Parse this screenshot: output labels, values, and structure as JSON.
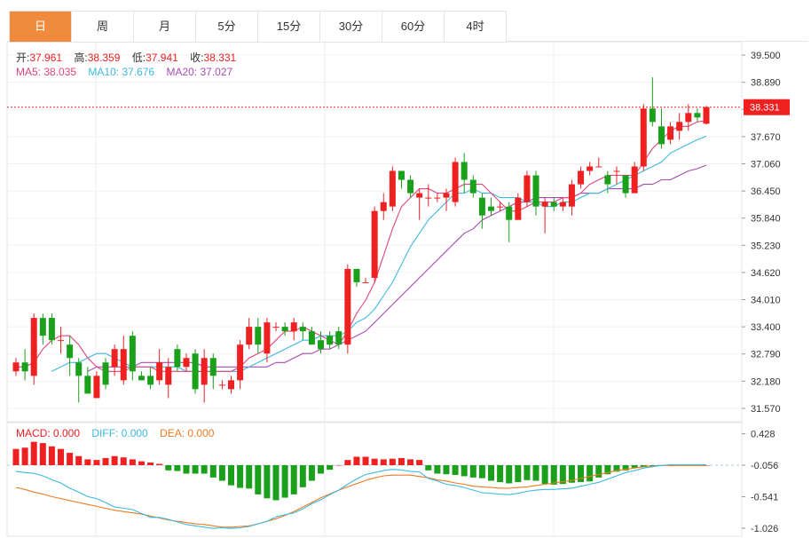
{
  "tabs": [
    {
      "label": "日",
      "active": true
    },
    {
      "label": "周",
      "active": false
    },
    {
      "label": "月",
      "active": false
    },
    {
      "label": "5分",
      "active": false
    },
    {
      "label": "15分",
      "active": false
    },
    {
      "label": "30分",
      "active": false
    },
    {
      "label": "60分",
      "active": false
    },
    {
      "label": "4时",
      "active": false
    }
  ],
  "ohlc_legend": {
    "open_label": "开:",
    "open": "37.961",
    "high_label": "高:",
    "high": "38.359",
    "low_label": "低:",
    "low": "37.941",
    "close_label": "收:",
    "close": "38.331"
  },
  "ma_legend": {
    "ma5": "MA5: 38.035",
    "ma10": "MA10: 37.676",
    "ma20": "MA20: 37.027"
  },
  "macd_legend": {
    "macd": "MACD: 0.000",
    "diff": "DIFF: 0.000",
    "dea": "DEA: 0.000"
  },
  "last_price_tag": "38.331",
  "colors": {
    "up": "#ee2020",
    "down": "#1aa01a",
    "ma5": "#e0457b",
    "ma10": "#3cb9e0",
    "ma20": "#a64cb3",
    "dea": "#f07a20",
    "active_tab": "#f08a3c"
  },
  "chart_data": [
    {
      "type": "candlestick",
      "ylim": [
        31.27,
        39.8
      ],
      "yticks": [
        "39.500",
        "38.890",
        "38.280",
        "37.670",
        "37.060",
        "36.450",
        "35.840",
        "35.230",
        "34.620",
        "34.010",
        "33.400",
        "32.790",
        "32.180",
        "31.570"
      ],
      "candles": [
        [
          32.4,
          32.6,
          32.3,
          32.7
        ],
        [
          32.6,
          32.4,
          32.2,
          32.9
        ],
        [
          32.3,
          33.6,
          32.1,
          33.7
        ],
        [
          33.6,
          33.2,
          33.0,
          33.7
        ],
        [
          33.6,
          33.1,
          33.0,
          33.7
        ],
        [
          33.1,
          33.1,
          32.8,
          33.4
        ],
        [
          33.0,
          32.7,
          32.3,
          33.2
        ],
        [
          32.6,
          32.3,
          31.7,
          32.7
        ],
        [
          32.3,
          31.9,
          31.9,
          32.5
        ],
        [
          31.8,
          32.3,
          31.8,
          32.4
        ],
        [
          32.6,
          32.1,
          32.0,
          32.7
        ],
        [
          32.5,
          32.9,
          32.3,
          33.0
        ],
        [
          32.2,
          32.9,
          32.1,
          33.2
        ],
        [
          33.2,
          32.4,
          32.2,
          33.3
        ],
        [
          32.3,
          32.2,
          32.2,
          32.4
        ],
        [
          32.3,
          32.1,
          32.0,
          32.5
        ],
        [
          32.2,
          32.6,
          32.1,
          32.9
        ],
        [
          32.1,
          32.5,
          31.8,
          32.7
        ],
        [
          32.9,
          32.5,
          32.4,
          33.0
        ],
        [
          32.5,
          32.7,
          32.4,
          32.8
        ],
        [
          32.8,
          32.0,
          31.9,
          32.9
        ],
        [
          32.1,
          32.7,
          31.7,
          32.9
        ],
        [
          32.7,
          32.3,
          32.0,
          32.8
        ],
        [
          32.1,
          32.1,
          32.0,
          32.2
        ],
        [
          32.0,
          32.2,
          31.9,
          32.3
        ],
        [
          32.2,
          33.0,
          32.0,
          33.1
        ],
        [
          33.0,
          33.4,
          32.9,
          33.6
        ],
        [
          33.4,
          33.0,
          32.8,
          33.6
        ],
        [
          32.8,
          33.5,
          32.6,
          33.6
        ],
        [
          33.4,
          33.4,
          33.3,
          33.5
        ],
        [
          33.4,
          33.3,
          33.2,
          33.5
        ],
        [
          33.3,
          33.5,
          33.1,
          33.6
        ],
        [
          33.4,
          33.3,
          33.1,
          33.5
        ],
        [
          33.3,
          33.0,
          33.0,
          33.4
        ],
        [
          33.1,
          32.9,
          32.8,
          33.3
        ],
        [
          33.2,
          33.0,
          32.9,
          33.3
        ],
        [
          33.3,
          33.0,
          32.9,
          33.4
        ],
        [
          33.0,
          34.7,
          32.8,
          34.8
        ],
        [
          34.7,
          34.4,
          34.3,
          34.7
        ],
        [
          34.4,
          34.4,
          34.4,
          34.5
        ],
        [
          34.5,
          36.0,
          34.4,
          36.1
        ],
        [
          36.0,
          36.2,
          35.8,
          36.4
        ],
        [
          36.1,
          36.9,
          36.0,
          37.0
        ],
        [
          36.9,
          36.7,
          36.5,
          36.9
        ],
        [
          36.7,
          36.4,
          36.3,
          36.8
        ],
        [
          36.3,
          36.4,
          35.8,
          36.5
        ],
        [
          36.3,
          36.3,
          36.1,
          36.6
        ],
        [
          36.3,
          36.3,
          36.2,
          36.4
        ],
        [
          36.3,
          36.4,
          36.0,
          36.5
        ],
        [
          36.2,
          37.1,
          36.1,
          37.2
        ],
        [
          37.1,
          36.7,
          36.4,
          37.3
        ],
        [
          36.7,
          36.4,
          36.3,
          36.8
        ],
        [
          36.3,
          35.9,
          35.6,
          36.4
        ],
        [
          36.1,
          36.0,
          35.9,
          36.3
        ],
        [
          36.1,
          36.1,
          36.0,
          36.2
        ],
        [
          36.1,
          35.8,
          35.3,
          36.2
        ],
        [
          35.8,
          36.3,
          35.8,
          36.4
        ],
        [
          36.2,
          36.8,
          36.1,
          36.9
        ],
        [
          36.8,
          36.1,
          35.9,
          36.9
        ],
        [
          36.1,
          36.2,
          35.5,
          36.3
        ],
        [
          36.2,
          36.1,
          36.0,
          36.3
        ],
        [
          36.1,
          36.2,
          36.0,
          36.3
        ],
        [
          36.1,
          36.6,
          35.9,
          36.7
        ],
        [
          36.6,
          36.9,
          36.5,
          37.0
        ],
        [
          36.9,
          37.0,
          36.8,
          37.1
        ],
        [
          37.0,
          37.0,
          37.0,
          37.2
        ],
        [
          36.8,
          36.6,
          36.4,
          36.9
        ],
        [
          36.9,
          36.9,
          36.6,
          37.0
        ],
        [
          36.8,
          36.4,
          36.3,
          36.8
        ],
        [
          36.4,
          37.0,
          36.4,
          37.1
        ],
        [
          37.0,
          38.3,
          36.9,
          38.4
        ],
        [
          38.3,
          38.0,
          37.9,
          39.0
        ],
        [
          37.9,
          37.5,
          37.4,
          38.3
        ],
        [
          37.6,
          37.9,
          37.5,
          38.0
        ],
        [
          37.8,
          38.0,
          37.6,
          38.2
        ],
        [
          38.0,
          38.2,
          37.8,
          38.4
        ],
        [
          38.2,
          38.1,
          38.0,
          38.3
        ],
        [
          37.96,
          38.331,
          37.941,
          38.359
        ]
      ],
      "ma5": [
        32.5,
        32.5,
        32.6,
        32.9,
        33.1,
        33.2,
        33.2,
        33.0,
        32.7,
        32.5,
        32.4,
        32.4,
        32.4,
        32.5,
        32.5,
        32.5,
        32.4,
        32.4,
        32.4,
        32.4,
        32.4,
        32.4,
        32.4,
        32.4,
        32.4,
        32.5,
        32.7,
        32.8,
        32.9,
        33.1,
        33.3,
        33.3,
        33.4,
        33.3,
        33.2,
        33.1,
        33.0,
        33.3,
        33.7,
        34.0,
        34.4,
        35.0,
        35.6,
        36.1,
        36.3,
        36.5,
        36.5,
        36.4,
        36.4,
        36.5,
        36.6,
        36.6,
        36.6,
        36.4,
        36.2,
        36.0,
        36.0,
        36.1,
        36.2,
        36.2,
        36.2,
        36.3,
        36.3,
        36.4,
        36.6,
        36.7,
        36.8,
        36.8,
        36.8,
        36.8,
        37.1,
        37.4,
        37.6,
        37.8,
        37.9,
        37.9,
        38.0,
        38.03
      ],
      "ma10": [
        null,
        null,
        null,
        null,
        32.4,
        32.5,
        32.6,
        32.6,
        32.7,
        32.8,
        32.8,
        32.7,
        32.6,
        32.5,
        32.5,
        32.5,
        32.5,
        32.5,
        32.5,
        32.4,
        32.4,
        32.4,
        32.4,
        32.4,
        32.4,
        32.4,
        32.5,
        32.6,
        32.7,
        32.8,
        32.9,
        33.0,
        33.1,
        33.1,
        33.2,
        33.2,
        33.2,
        33.3,
        33.5,
        33.6,
        33.8,
        34.1,
        34.4,
        34.8,
        35.2,
        35.5,
        35.8,
        36.0,
        36.2,
        36.4,
        36.4,
        36.5,
        36.4,
        36.4,
        36.3,
        36.3,
        36.3,
        36.2,
        36.2,
        36.1,
        36.1,
        36.2,
        36.2,
        36.3,
        36.4,
        36.4,
        36.5,
        36.6,
        36.7,
        36.8,
        36.9,
        37.0,
        37.1,
        37.3,
        37.4,
        37.5,
        37.6,
        37.68
      ],
      "ma20": [
        null,
        null,
        null,
        null,
        null,
        null,
        null,
        null,
        32.4,
        32.5,
        32.5,
        32.5,
        32.5,
        32.5,
        32.6,
        32.6,
        32.6,
        32.6,
        32.6,
        32.6,
        32.6,
        32.5,
        32.5,
        32.5,
        32.5,
        32.5,
        32.5,
        32.5,
        32.5,
        32.6,
        32.6,
        32.7,
        32.8,
        32.8,
        32.9,
        32.9,
        33.0,
        33.1,
        33.2,
        33.3,
        33.5,
        33.7,
        33.9,
        34.1,
        34.3,
        34.5,
        34.7,
        34.9,
        35.1,
        35.3,
        35.5,
        35.6,
        35.8,
        35.9,
        36.0,
        36.1,
        36.2,
        36.2,
        36.3,
        36.3,
        36.3,
        36.3,
        36.3,
        36.4,
        36.4,
        36.4,
        36.5,
        36.5,
        36.5,
        36.5,
        36.6,
        36.6,
        36.7,
        36.7,
        36.8,
        36.9,
        36.95,
        37.03
      ]
    },
    {
      "type": "bar",
      "series_name": "MACD",
      "ylim": [
        -1.15,
        0.6
      ],
      "yticks": [
        "0.428",
        "-0.056",
        "-0.541",
        "-1.026"
      ],
      "zero": -0.056,
      "histogram": [
        0.25,
        0.27,
        0.36,
        0.34,
        0.29,
        0.25,
        0.19,
        0.14,
        0.09,
        0.08,
        0.11,
        0.14,
        0.12,
        0.09,
        0.06,
        0.04,
        0.02,
        -0.08,
        -0.09,
        -0.13,
        -0.13,
        -0.13,
        -0.19,
        -0.24,
        -0.31,
        -0.35,
        -0.36,
        -0.45,
        -0.51,
        -0.54,
        -0.5,
        -0.45,
        -0.34,
        -0.24,
        -0.13,
        -0.07,
        0.0,
        0.08,
        0.13,
        0.13,
        0.1,
        0.09,
        0.1,
        0.11,
        0.09,
        0.08,
        -0.08,
        -0.13,
        -0.14,
        -0.15,
        -0.17,
        -0.19,
        -0.2,
        -0.24,
        -0.26,
        -0.28,
        -0.26,
        -0.23,
        -0.24,
        -0.29,
        -0.3,
        -0.29,
        -0.27,
        -0.26,
        -0.25,
        -0.19,
        -0.14,
        -0.1,
        -0.08,
        -0.04,
        -0.03,
        -0.02,
        -0.01,
        -0.01,
        0.0,
        0.0,
        0.0,
        0.0
      ],
      "diff": [
        -0.15,
        -0.17,
        -0.18,
        -0.22,
        -0.28,
        -0.33,
        -0.41,
        -0.47,
        -0.54,
        -0.57,
        -0.63,
        -0.7,
        -0.72,
        -0.74,
        -0.8,
        -0.86,
        -0.86,
        -0.89,
        -0.93,
        -0.97,
        -0.99,
        -1.01,
        -1.03,
        -1.02,
        -1.03,
        -1.02,
        -1.0,
        -0.96,
        -0.92,
        -0.85,
        -0.82,
        -0.79,
        -0.73,
        -0.65,
        -0.59,
        -0.51,
        -0.44,
        -0.35,
        -0.27,
        -0.2,
        -0.17,
        -0.14,
        -0.12,
        -0.13,
        -0.15,
        -0.16,
        -0.26,
        -0.3,
        -0.35,
        -0.37,
        -0.4,
        -0.44,
        -0.48,
        -0.49,
        -0.5,
        -0.51,
        -0.49,
        -0.46,
        -0.44,
        -0.43,
        -0.43,
        -0.42,
        -0.41,
        -0.38,
        -0.35,
        -0.32,
        -0.27,
        -0.22,
        -0.17,
        -0.14,
        -0.1,
        -0.08,
        -0.06,
        -0.05,
        -0.05,
        -0.05,
        -0.05,
        -0.05
      ],
      "dea": [
        -0.4,
        -0.43,
        -0.47,
        -0.5,
        -0.54,
        -0.57,
        -0.6,
        -0.63,
        -0.66,
        -0.69,
        -0.72,
        -0.75,
        -0.77,
        -0.79,
        -0.81,
        -0.84,
        -0.87,
        -0.9,
        -0.92,
        -0.94,
        -0.96,
        -0.97,
        -0.99,
        -1.01,
        -1.01,
        -1.0,
        -0.99,
        -0.96,
        -0.92,
        -0.88,
        -0.83,
        -0.77,
        -0.7,
        -0.63,
        -0.56,
        -0.5,
        -0.44,
        -0.39,
        -0.34,
        -0.29,
        -0.25,
        -0.22,
        -0.21,
        -0.21,
        -0.21,
        -0.23,
        -0.25,
        -0.28,
        -0.3,
        -0.33,
        -0.35,
        -0.38,
        -0.39,
        -0.4,
        -0.41,
        -0.41,
        -0.4,
        -0.39,
        -0.37,
        -0.35,
        -0.33,
        -0.31,
        -0.29,
        -0.26,
        -0.23,
        -0.2,
        -0.17,
        -0.14,
        -0.12,
        -0.1,
        -0.08,
        -0.07,
        -0.06,
        -0.06,
        -0.06,
        -0.06,
        -0.06,
        -0.06
      ]
    }
  ]
}
